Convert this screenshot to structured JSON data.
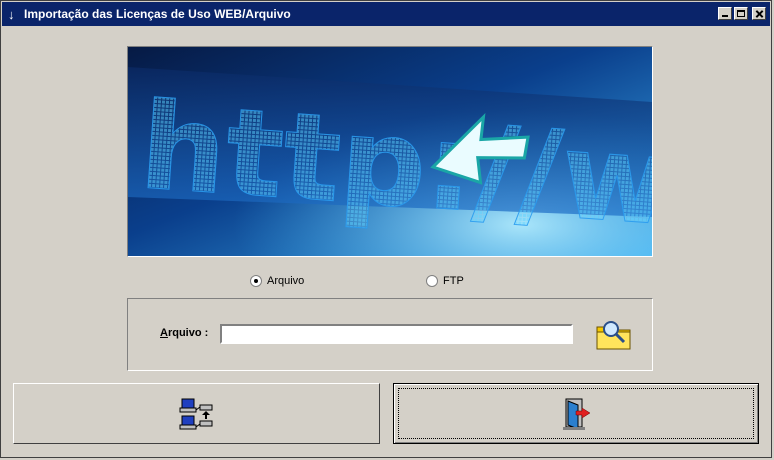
{
  "window": {
    "title": "Importação das Licenças de Uso WEB/Arquivo",
    "title_icon": "down-arrow-icon"
  },
  "banner": {
    "text": "http://www.",
    "icon": "web-address-pointer-image"
  },
  "source_options": {
    "selected": "Arquivo",
    "arquivo_label": "Arquivo",
    "ftp_label": "FTP"
  },
  "file_group": {
    "label": "Arquivo :",
    "label_accesskey": "A",
    "label_rest": "rquivo :",
    "input_value": "",
    "browse_icon": "folder-search-icon"
  },
  "buttons": {
    "import_icon": "network-transfer-icon",
    "exit_icon": "exit-door-icon"
  },
  "colors": {
    "titlebar": "#0a246a",
    "window_bg": "#d4d0c8",
    "banner_glow": "#36b4ff"
  }
}
